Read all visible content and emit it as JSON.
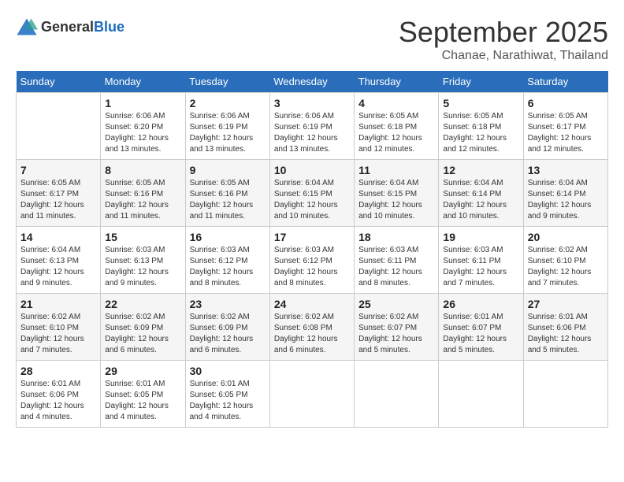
{
  "header": {
    "logo": {
      "general": "General",
      "blue": "Blue"
    },
    "month_title": "September 2025",
    "subtitle": "Chanae, Narathiwat, Thailand"
  },
  "weekdays": [
    "Sunday",
    "Monday",
    "Tuesday",
    "Wednesday",
    "Thursday",
    "Friday",
    "Saturday"
  ],
  "weeks": [
    [
      {
        "day": null,
        "info": null
      },
      {
        "day": "1",
        "info": "Sunrise: 6:06 AM\nSunset: 6:20 PM\nDaylight: 12 hours\nand 13 minutes."
      },
      {
        "day": "2",
        "info": "Sunrise: 6:06 AM\nSunset: 6:19 PM\nDaylight: 12 hours\nand 13 minutes."
      },
      {
        "day": "3",
        "info": "Sunrise: 6:06 AM\nSunset: 6:19 PM\nDaylight: 12 hours\nand 13 minutes."
      },
      {
        "day": "4",
        "info": "Sunrise: 6:05 AM\nSunset: 6:18 PM\nDaylight: 12 hours\nand 12 minutes."
      },
      {
        "day": "5",
        "info": "Sunrise: 6:05 AM\nSunset: 6:18 PM\nDaylight: 12 hours\nand 12 minutes."
      },
      {
        "day": "6",
        "info": "Sunrise: 6:05 AM\nSunset: 6:17 PM\nDaylight: 12 hours\nand 12 minutes."
      }
    ],
    [
      {
        "day": "7",
        "info": "Sunrise: 6:05 AM\nSunset: 6:17 PM\nDaylight: 12 hours\nand 11 minutes."
      },
      {
        "day": "8",
        "info": "Sunrise: 6:05 AM\nSunset: 6:16 PM\nDaylight: 12 hours\nand 11 minutes."
      },
      {
        "day": "9",
        "info": "Sunrise: 6:05 AM\nSunset: 6:16 PM\nDaylight: 12 hours\nand 11 minutes."
      },
      {
        "day": "10",
        "info": "Sunrise: 6:04 AM\nSunset: 6:15 PM\nDaylight: 12 hours\nand 10 minutes."
      },
      {
        "day": "11",
        "info": "Sunrise: 6:04 AM\nSunset: 6:15 PM\nDaylight: 12 hours\nand 10 minutes."
      },
      {
        "day": "12",
        "info": "Sunrise: 6:04 AM\nSunset: 6:14 PM\nDaylight: 12 hours\nand 10 minutes."
      },
      {
        "day": "13",
        "info": "Sunrise: 6:04 AM\nSunset: 6:14 PM\nDaylight: 12 hours\nand 9 minutes."
      }
    ],
    [
      {
        "day": "14",
        "info": "Sunrise: 6:04 AM\nSunset: 6:13 PM\nDaylight: 12 hours\nand 9 minutes."
      },
      {
        "day": "15",
        "info": "Sunrise: 6:03 AM\nSunset: 6:13 PM\nDaylight: 12 hours\nand 9 minutes."
      },
      {
        "day": "16",
        "info": "Sunrise: 6:03 AM\nSunset: 6:12 PM\nDaylight: 12 hours\nand 8 minutes."
      },
      {
        "day": "17",
        "info": "Sunrise: 6:03 AM\nSunset: 6:12 PM\nDaylight: 12 hours\nand 8 minutes."
      },
      {
        "day": "18",
        "info": "Sunrise: 6:03 AM\nSunset: 6:11 PM\nDaylight: 12 hours\nand 8 minutes."
      },
      {
        "day": "19",
        "info": "Sunrise: 6:03 AM\nSunset: 6:11 PM\nDaylight: 12 hours\nand 7 minutes."
      },
      {
        "day": "20",
        "info": "Sunrise: 6:02 AM\nSunset: 6:10 PM\nDaylight: 12 hours\nand 7 minutes."
      }
    ],
    [
      {
        "day": "21",
        "info": "Sunrise: 6:02 AM\nSunset: 6:10 PM\nDaylight: 12 hours\nand 7 minutes."
      },
      {
        "day": "22",
        "info": "Sunrise: 6:02 AM\nSunset: 6:09 PM\nDaylight: 12 hours\nand 6 minutes."
      },
      {
        "day": "23",
        "info": "Sunrise: 6:02 AM\nSunset: 6:09 PM\nDaylight: 12 hours\nand 6 minutes."
      },
      {
        "day": "24",
        "info": "Sunrise: 6:02 AM\nSunset: 6:08 PM\nDaylight: 12 hours\nand 6 minutes."
      },
      {
        "day": "25",
        "info": "Sunrise: 6:02 AM\nSunset: 6:07 PM\nDaylight: 12 hours\nand 5 minutes."
      },
      {
        "day": "26",
        "info": "Sunrise: 6:01 AM\nSunset: 6:07 PM\nDaylight: 12 hours\nand 5 minutes."
      },
      {
        "day": "27",
        "info": "Sunrise: 6:01 AM\nSunset: 6:06 PM\nDaylight: 12 hours\nand 5 minutes."
      }
    ],
    [
      {
        "day": "28",
        "info": "Sunrise: 6:01 AM\nSunset: 6:06 PM\nDaylight: 12 hours\nand 4 minutes."
      },
      {
        "day": "29",
        "info": "Sunrise: 6:01 AM\nSunset: 6:05 PM\nDaylight: 12 hours\nand 4 minutes."
      },
      {
        "day": "30",
        "info": "Sunrise: 6:01 AM\nSunset: 6:05 PM\nDaylight: 12 hours\nand 4 minutes."
      },
      {
        "day": null,
        "info": null
      },
      {
        "day": null,
        "info": null
      },
      {
        "day": null,
        "info": null
      },
      {
        "day": null,
        "info": null
      }
    ]
  ]
}
